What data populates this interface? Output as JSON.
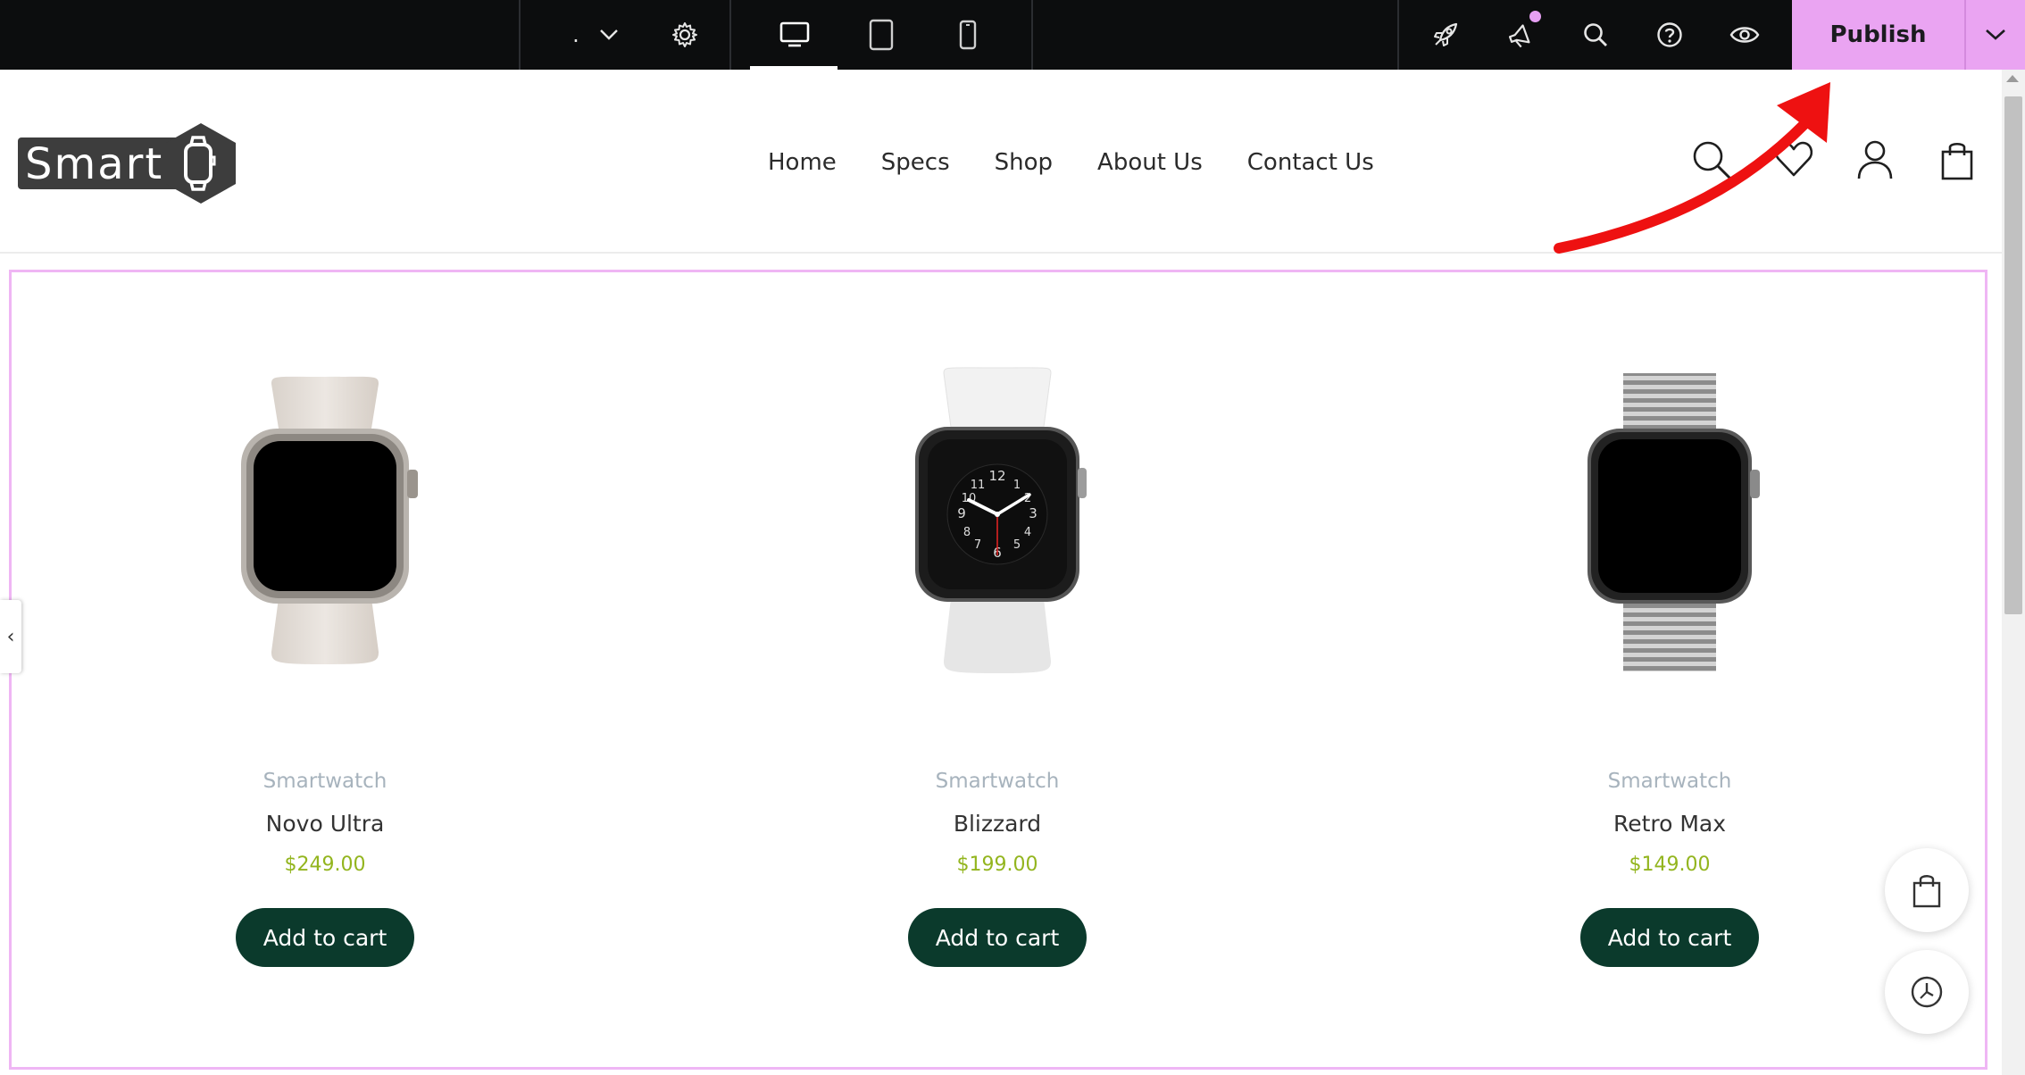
{
  "editor": {
    "page_selector": ".",
    "publish_label": "Publish",
    "accent": "#eaa4f2"
  },
  "site": {
    "logo_text": "Smart",
    "nav": [
      "Home",
      "Specs",
      "Shop",
      "About Us",
      "Contact Us"
    ]
  },
  "products": [
    {
      "category": "Smartwatch",
      "name": "Novo Ultra",
      "price": "$249.00",
      "button": "Add to cart",
      "band": "sand"
    },
    {
      "category": "Smartwatch",
      "name": "Blizzard",
      "price": "$199.00",
      "button": "Add to cart",
      "band": "white"
    },
    {
      "category": "Smartwatch",
      "name": "Retro Max",
      "price": "$149.00",
      "button": "Add to cart",
      "band": "steel"
    }
  ],
  "colors": {
    "price": "#93b51e",
    "button_bg": "#0b3a2c",
    "frame": "#efb6f4",
    "annotation_arrow": "#ee1111"
  }
}
